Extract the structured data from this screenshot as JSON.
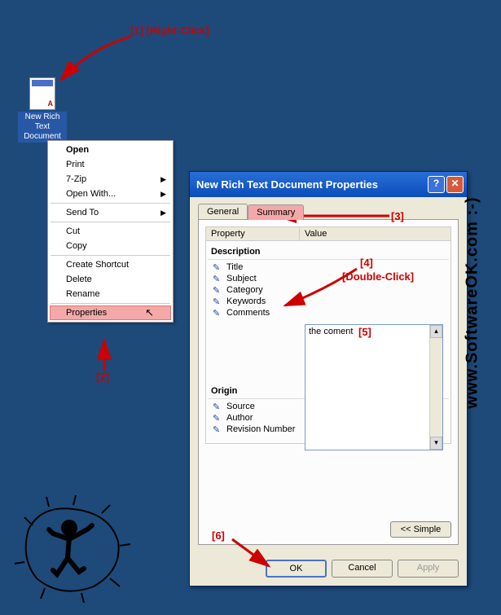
{
  "desktop": {
    "icon_label": "New Rich Text Document"
  },
  "context_menu": {
    "items": [
      {
        "label": "Open",
        "bold": true
      },
      {
        "label": "Print"
      },
      {
        "label": "7-Zip",
        "submenu": true
      },
      {
        "label": "Open With...",
        "submenu": true
      },
      {
        "sep": true
      },
      {
        "label": "Send To",
        "submenu": true
      },
      {
        "sep": true
      },
      {
        "label": "Cut"
      },
      {
        "label": "Copy"
      },
      {
        "sep": true
      },
      {
        "label": "Create Shortcut"
      },
      {
        "label": "Delete"
      },
      {
        "label": "Rename"
      },
      {
        "sep": true
      },
      {
        "label": "Properties",
        "highlighted": true
      }
    ]
  },
  "dialog": {
    "title": "New Rich Text Document Properties",
    "tabs": [
      {
        "label": "General"
      },
      {
        "label": "Summary",
        "active": true
      }
    ],
    "columns": {
      "property": "Property",
      "value": "Value"
    },
    "groups": {
      "description": {
        "label": "Description",
        "props": [
          "Title",
          "Subject",
          "Category",
          "Keywords",
          "Comments"
        ]
      },
      "origin": {
        "label": "Origin",
        "props": [
          "Source",
          "Author",
          "Revision Number"
        ]
      }
    },
    "comments_value": "the coment",
    "buttons": {
      "simple": "<< Simple",
      "ok": "OK",
      "cancel": "Cancel",
      "apply": "Apply"
    }
  },
  "annotations": {
    "a1": "[1]  [Right-Click]",
    "a2": "[2]",
    "a3": "[3]",
    "a4": "[4]",
    "a4b": "[Double-Click]",
    "a5": "[5]",
    "a6": "[6]"
  },
  "watermark": "www.SoftwareOK.com :-)"
}
